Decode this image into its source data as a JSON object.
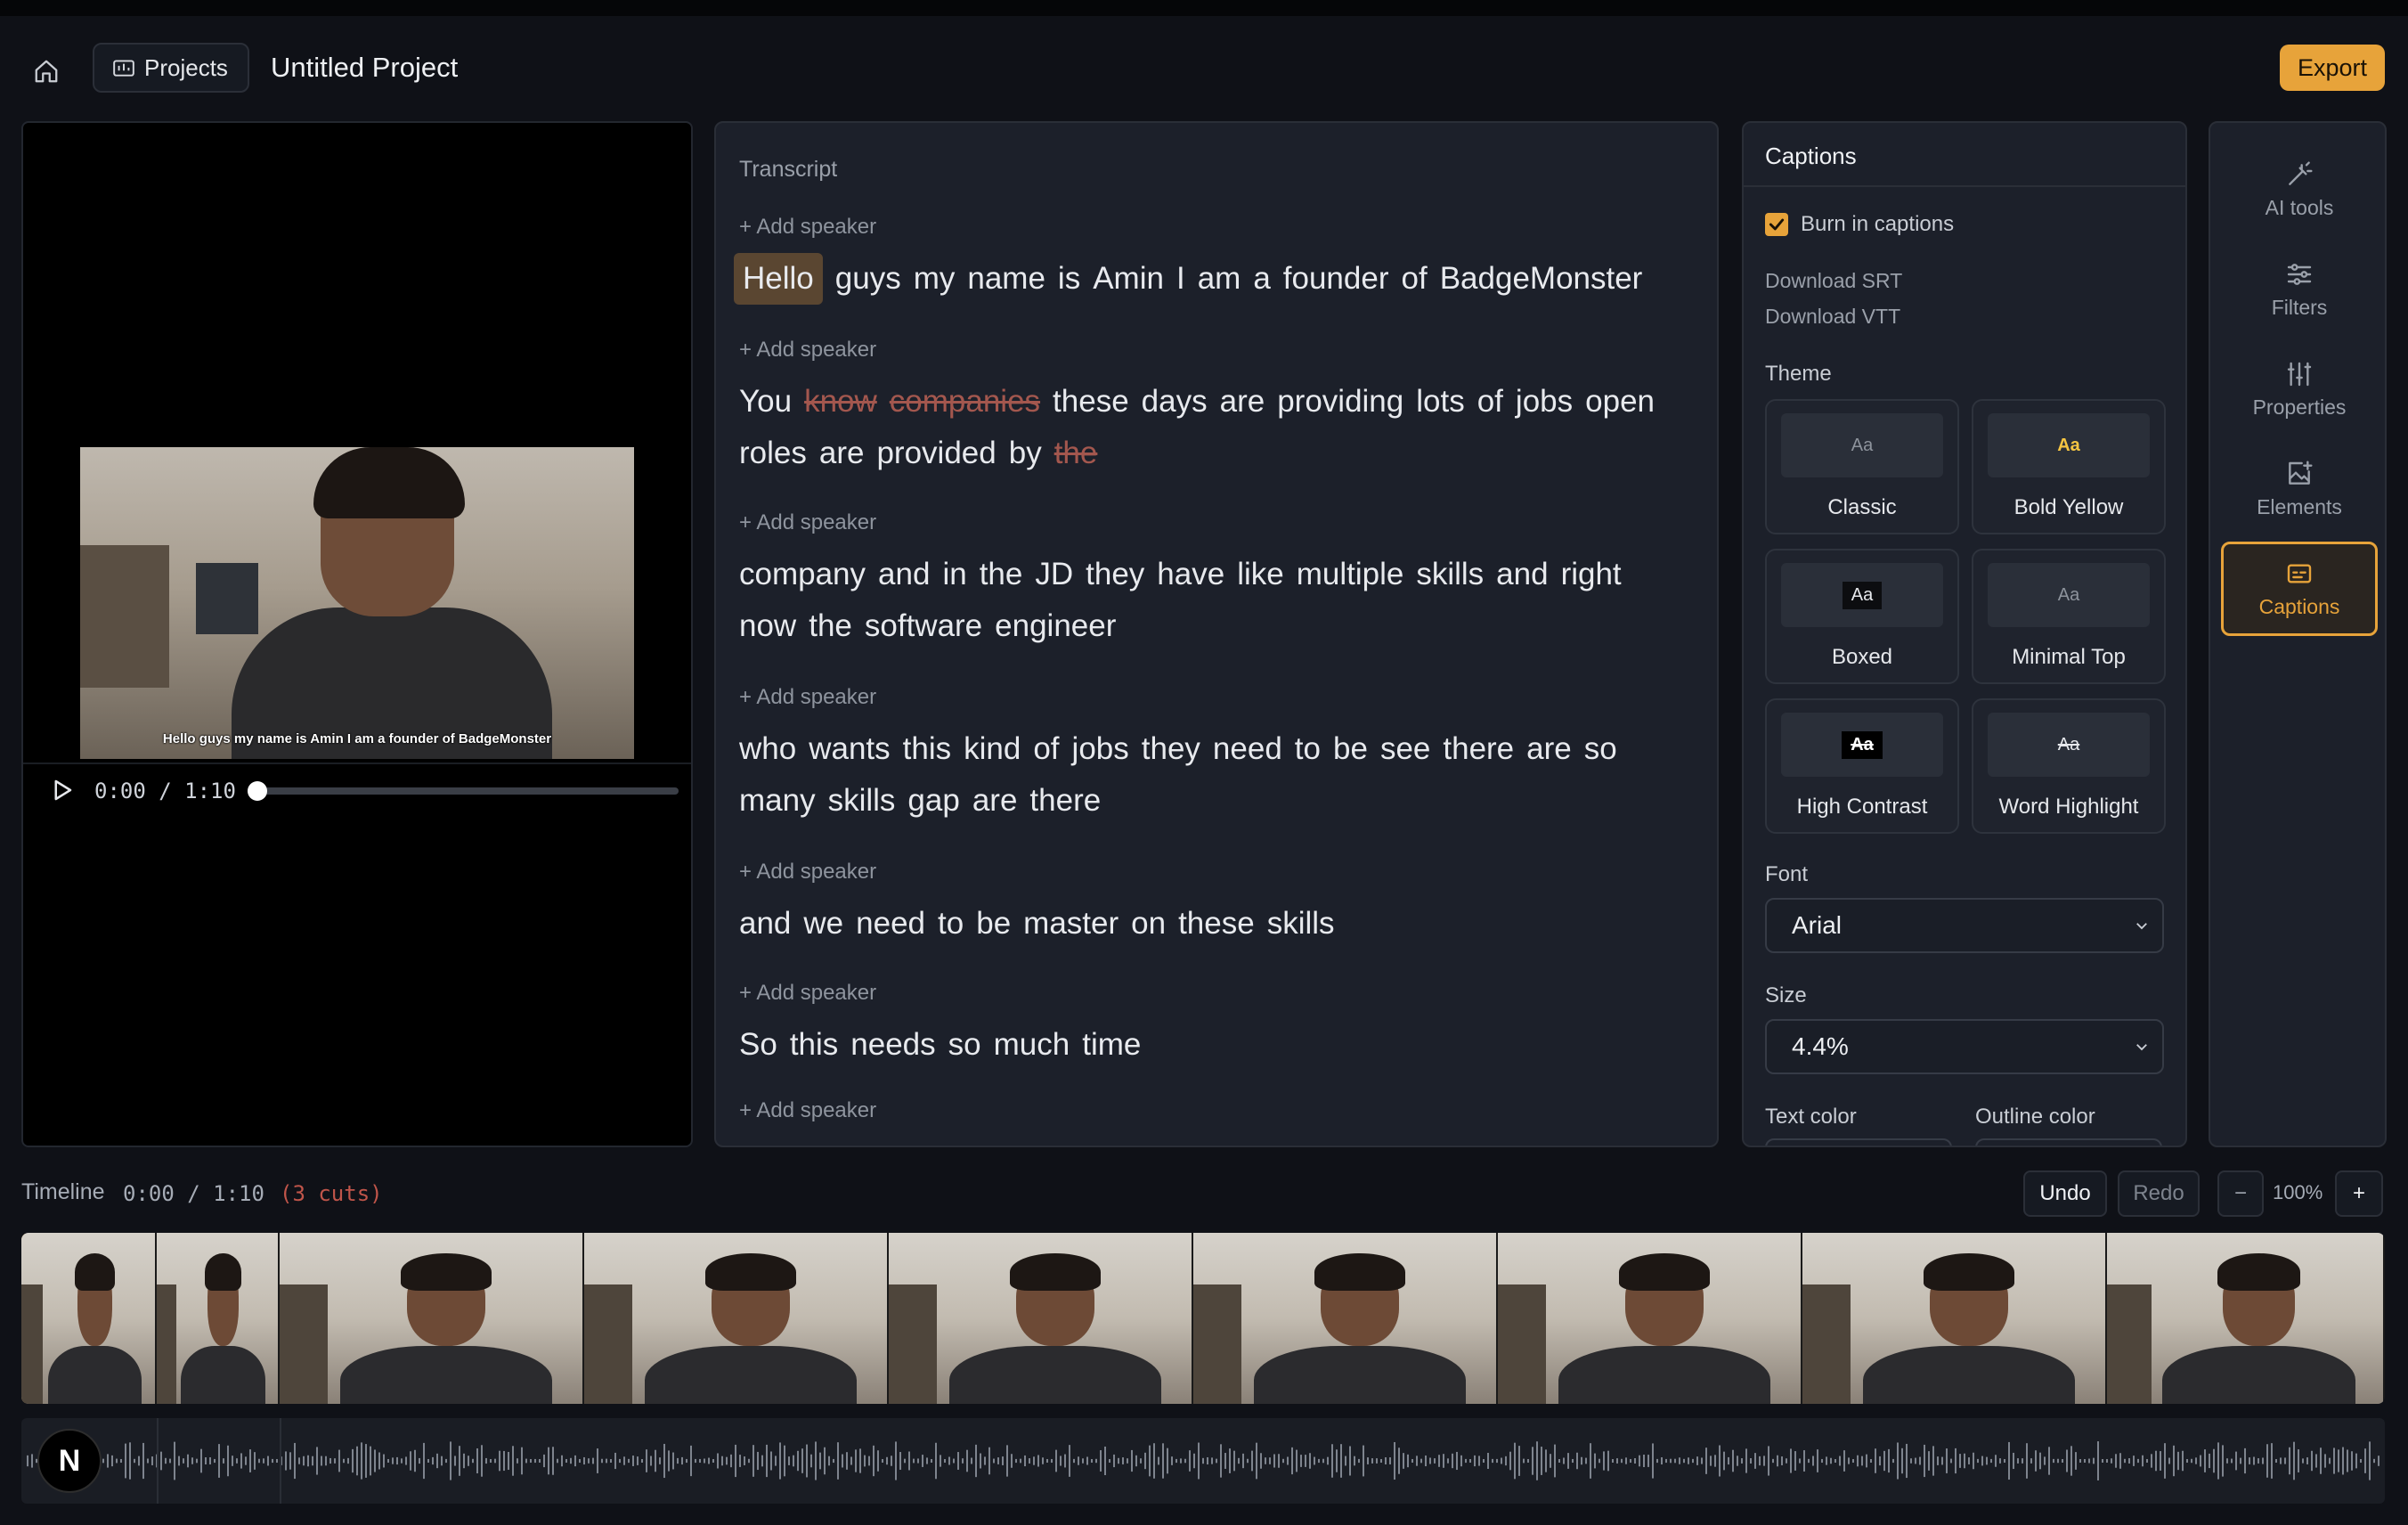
{
  "header": {
    "projects_label": "Projects",
    "project_title": "Untitled Project",
    "export_label": "Export"
  },
  "video": {
    "burned_caption": "Hello guys my name is Amin I am a founder of BadgeMonster",
    "current_time": "0:00",
    "separator": "/",
    "duration": "1:10",
    "progress": 0.0
  },
  "transcript": {
    "title": "Transcript",
    "add_speaker_label": "+ Add speaker",
    "segments": [
      {
        "words": [
          {
            "t": "Hello",
            "state": "highlight"
          },
          {
            "t": "guys"
          },
          {
            "t": "my"
          },
          {
            "t": "name"
          },
          {
            "t": "is"
          },
          {
            "t": "Amin"
          },
          {
            "t": "I"
          },
          {
            "t": "am"
          },
          {
            "t": "a"
          },
          {
            "t": "founder"
          },
          {
            "t": "of"
          },
          {
            "t": "BadgeMonster"
          }
        ]
      },
      {
        "words": [
          {
            "t": "You"
          },
          {
            "t": "know",
            "state": "cut"
          },
          {
            "t": "companies",
            "state": "cut"
          },
          {
            "t": "these"
          },
          {
            "t": "days"
          },
          {
            "t": "are"
          },
          {
            "t": "providing"
          },
          {
            "t": "lots"
          },
          {
            "t": "of"
          },
          {
            "t": "jobs"
          },
          {
            "t": "open"
          },
          {
            "t": "roles"
          },
          {
            "t": "are"
          },
          {
            "t": "provided"
          },
          {
            "t": "by"
          },
          {
            "t": "the",
            "state": "cut"
          }
        ]
      },
      {
        "words": [
          {
            "t": "company"
          },
          {
            "t": "and"
          },
          {
            "t": "in"
          },
          {
            "t": "the"
          },
          {
            "t": "JD"
          },
          {
            "t": "they"
          },
          {
            "t": "have"
          },
          {
            "t": "like"
          },
          {
            "t": "multiple"
          },
          {
            "t": "skills"
          },
          {
            "t": "and"
          },
          {
            "t": "right"
          },
          {
            "t": "now"
          },
          {
            "t": "the"
          },
          {
            "t": "software"
          },
          {
            "t": "engineer"
          }
        ]
      },
      {
        "words": [
          {
            "t": "who"
          },
          {
            "t": "wants"
          },
          {
            "t": "this"
          },
          {
            "t": "kind"
          },
          {
            "t": "of"
          },
          {
            "t": "jobs"
          },
          {
            "t": "they"
          },
          {
            "t": "need"
          },
          {
            "t": "to"
          },
          {
            "t": "be"
          },
          {
            "t": "see"
          },
          {
            "t": "there"
          },
          {
            "t": "are"
          },
          {
            "t": "so"
          },
          {
            "t": "many"
          },
          {
            "t": "skills"
          },
          {
            "t": "gap"
          },
          {
            "t": "are"
          },
          {
            "t": "there"
          }
        ]
      },
      {
        "words": [
          {
            "t": "and"
          },
          {
            "t": "we"
          },
          {
            "t": "need"
          },
          {
            "t": "to"
          },
          {
            "t": "be"
          },
          {
            "t": "master"
          },
          {
            "t": "on"
          },
          {
            "t": "these"
          },
          {
            "t": "skills"
          }
        ]
      },
      {
        "words": [
          {
            "t": "So"
          },
          {
            "t": "this"
          },
          {
            "t": "needs"
          },
          {
            "t": "so"
          },
          {
            "t": "much"
          },
          {
            "t": "time"
          }
        ]
      }
    ]
  },
  "captions": {
    "title": "Captions",
    "burn_in_label": "Burn in captions",
    "burn_in_checked": true,
    "download_srt": "Download SRT",
    "download_vtt": "Download VTT",
    "theme_label": "Theme",
    "themes": [
      {
        "name": "Classic",
        "preview": "Aa"
      },
      {
        "name": "Bold Yellow",
        "preview": "Aa"
      },
      {
        "name": "Boxed",
        "preview": "Aa"
      },
      {
        "name": "Minimal Top",
        "preview": "Aa"
      },
      {
        "name": "High Contrast",
        "preview": "Aa"
      },
      {
        "name": "Word Highlight",
        "preview": "Aa"
      }
    ],
    "font_label": "Font",
    "font_value": "Arial",
    "size_label": "Size",
    "size_value": "4.4%",
    "text_color_label": "Text color",
    "outline_color_label": "Outline color"
  },
  "sidebar": {
    "items": [
      {
        "label": "AI tools",
        "icon": "magic-wand-icon"
      },
      {
        "label": "Filters",
        "icon": "filters-icon"
      },
      {
        "label": "Properties",
        "icon": "sliders-icon"
      },
      {
        "label": "Elements",
        "icon": "image-plus-icon"
      },
      {
        "label": "Captions",
        "icon": "captions-icon",
        "active": true
      }
    ]
  },
  "timeline": {
    "label": "Timeline",
    "time": "0:00 / 1:10",
    "cuts": "(3 cuts)",
    "undo_label": "Undo",
    "redo_label": "Redo",
    "zoom_out_label": "−",
    "zoom_level": "100%",
    "zoom_in_label": "+"
  },
  "badge": {
    "letter": "N"
  },
  "colors": {
    "accent": "#e7a33a",
    "cut": "#c0554a",
    "panel": "#1c202a",
    "background": "#0f1117"
  }
}
